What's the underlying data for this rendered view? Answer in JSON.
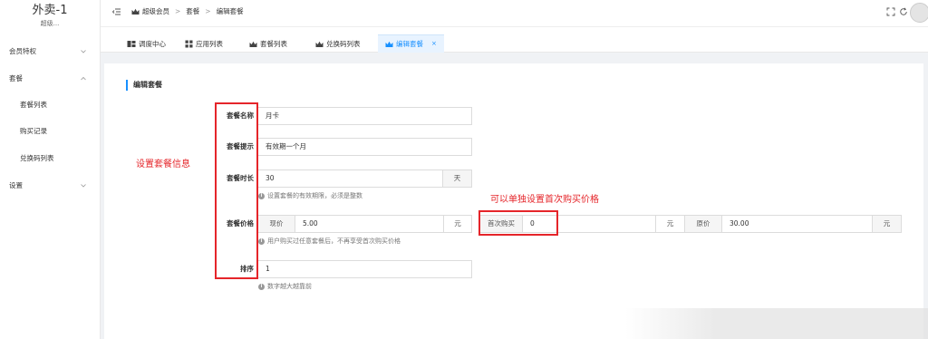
{
  "brand": {
    "title": "外卖-1",
    "subtitle": "超级..."
  },
  "sidebar": {
    "items": [
      {
        "label": "会员特权",
        "expandable": true
      },
      {
        "label": "套餐",
        "expandable": true,
        "expanded": true
      },
      {
        "label": "套餐列表",
        "sub": true
      },
      {
        "label": "购买记录",
        "sub": true
      },
      {
        "label": "兑换码列表",
        "sub": true
      },
      {
        "label": "设置",
        "expandable": true
      }
    ]
  },
  "breadcrumb": {
    "root": "超级会员",
    "sep": ">",
    "level2": "套餐",
    "level3": "编辑套餐"
  },
  "tabs": [
    {
      "label": "调度中心",
      "icon": "dashboard-icon"
    },
    {
      "label": "应用列表",
      "icon": "grid-icon"
    },
    {
      "label": "套餐列表",
      "icon": "crown-icon"
    },
    {
      "label": "兑换码列表",
      "icon": "crown-icon"
    },
    {
      "label": "编辑套餐",
      "icon": "crown-icon",
      "active": true,
      "close": "×"
    }
  ],
  "form": {
    "section_title": "编辑套餐",
    "name": {
      "label": "套餐名称",
      "value": "月卡"
    },
    "tip": {
      "label": "套餐提示",
      "value": "有效期一个月"
    },
    "duration": {
      "label": "套餐时长",
      "value": "30",
      "suffix": "天",
      "help": "设置套餐的有效期限，必须是整数"
    },
    "price": {
      "label": "套餐价格",
      "current_prefix": "现价",
      "current_value": "5.00",
      "current_suffix": "元",
      "first_prefix": "首次购买",
      "first_value": "0",
      "first_suffix": "元",
      "original_prefix": "原价",
      "original_value": "30.00",
      "original_suffix": "元",
      "help": "用户购买过任意套餐后，不再享受首次购买价格"
    },
    "sort": {
      "label": "排序",
      "value": "1",
      "help": "数字越大越靠前"
    }
  },
  "annotations": {
    "left": "设置套餐信息",
    "right": "可以单独设置首次购买价格"
  },
  "colors": {
    "accent": "#1890ff",
    "annotation": "#e5252a"
  }
}
